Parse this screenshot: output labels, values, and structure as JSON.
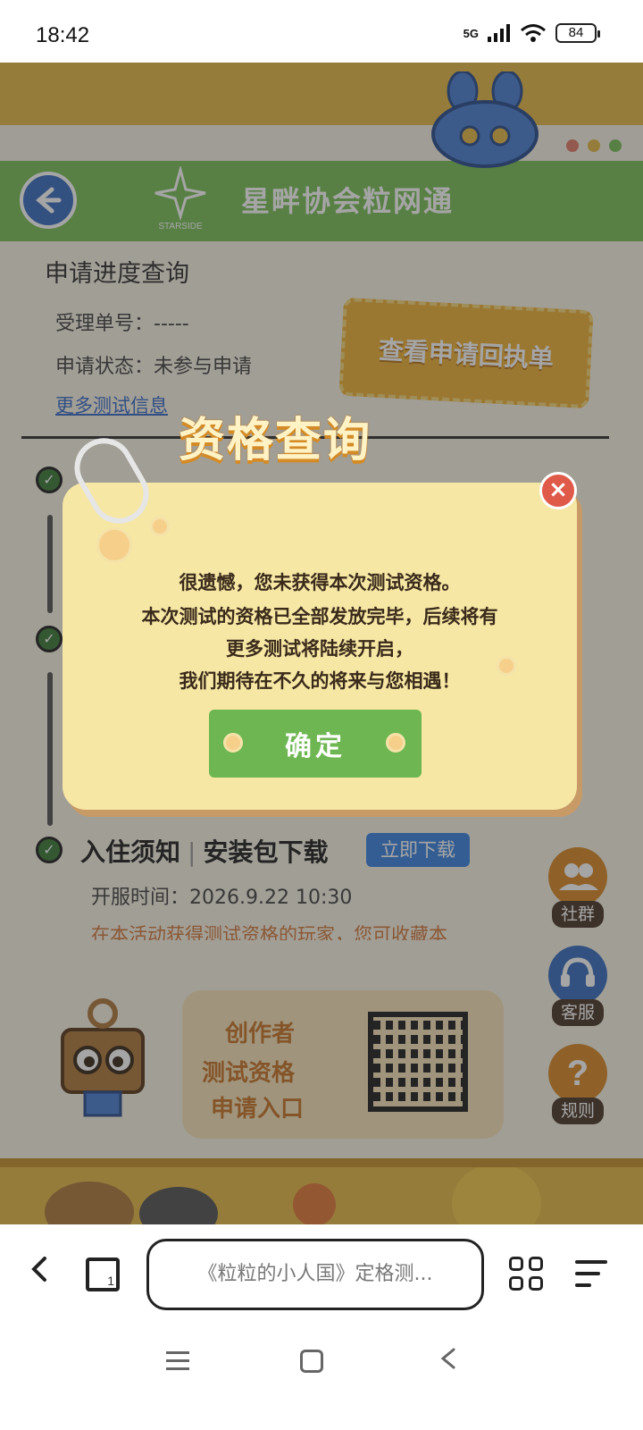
{
  "status_bar": {
    "time": "18:42",
    "network": "5G",
    "battery": "84",
    "icons": [
      "signal-icon",
      "wifi-icon",
      "battery-icon"
    ]
  },
  "site": {
    "logo_text": "STARSIDE",
    "title": "星畔协会粒网通"
  },
  "progress": {
    "section_title": "申请进度查询",
    "ticket_label": "受理单号：",
    "ticket_value": "-----",
    "status_label": "申请状态：",
    "status_value": "未参与申请",
    "more_link": "更多测试信息",
    "receipt_button": "查看申请回执单"
  },
  "steps": {
    "step3_title": "入住须知",
    "step3_separator": "|",
    "step3_sub": "安装包下载",
    "download_button": "立即下载",
    "open_time": "开服时间：2026.9.22   10:30",
    "faded_note": "在本活动获得测试资格的玩家，您可收藏本"
  },
  "side_buttons": [
    {
      "label": "社群",
      "icon": "community-icon",
      "color": "#d98b2a"
    },
    {
      "label": "客服",
      "icon": "headset-icon",
      "color": "#3b6fbf"
    },
    {
      "label": "规则",
      "icon": "question-icon",
      "color": "#d98b2a"
    }
  ],
  "creator_card": {
    "line1": "创作者",
    "line2": "测试资格",
    "line3": "申请入口"
  },
  "dialog": {
    "title": "资格查询",
    "line1": "很遗憾，您未获得本次测试资格。",
    "line2": "本次测试的资格已全部发放完毕，后续将有",
    "line3": "更多测试将陆续开启，",
    "line4": "我们期待在不久的将来与您相遇！",
    "confirm": "确定"
  },
  "browser": {
    "url_text": "《粒粒的小人国》定格测..."
  },
  "colors": {
    "accent_green": "#7bc05b",
    "accent_yellow": "#e6b948",
    "dialog_bg": "#f6e7a5",
    "link_blue": "#3a6cc7",
    "close_red": "#e05a4a"
  }
}
